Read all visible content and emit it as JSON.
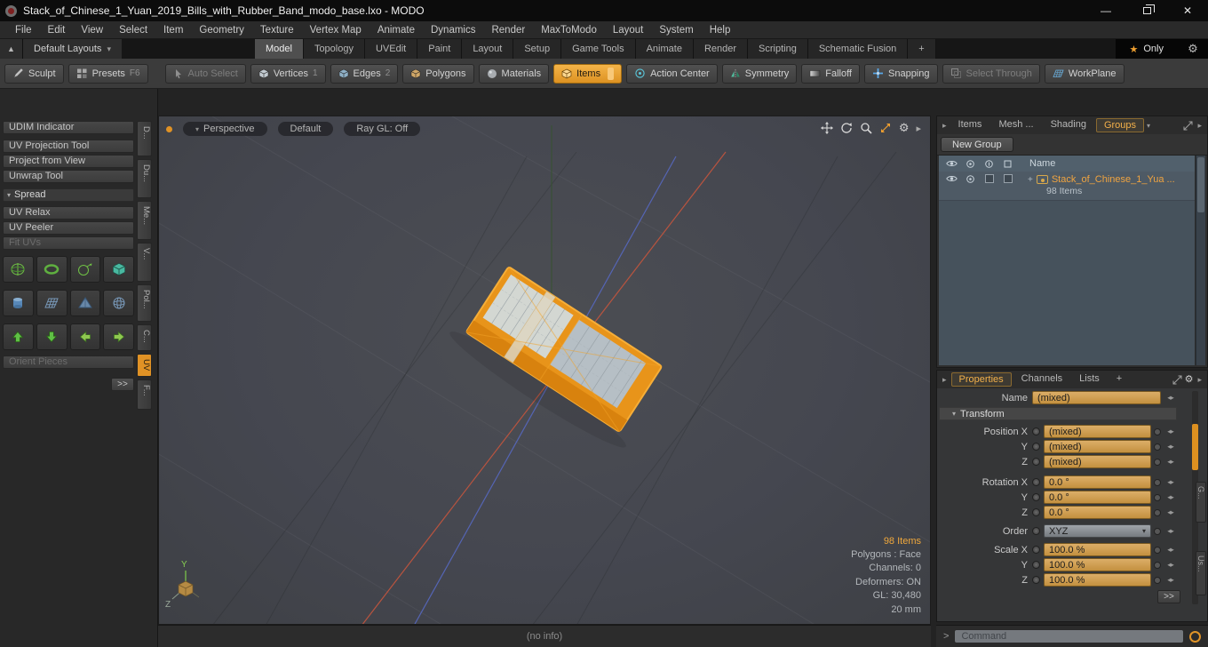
{
  "window": {
    "title": "Stack_of_Chinese_1_Yuan_2019_Bills_with_Rubber_Band_modo_base.lxo - MODO"
  },
  "icons": {
    "dropdown": "▾",
    "collapse": "▸",
    "section_open": "▼",
    "star": "★",
    "gear": "⚙",
    "up": "▲",
    "spin": "◂▸",
    "plus": "+",
    "minimize": "—",
    "close": "✕",
    "gt": ">"
  },
  "menu": {
    "items": [
      "File",
      "Edit",
      "View",
      "Select",
      "Item",
      "Geometry",
      "Texture",
      "Vertex Map",
      "Animate",
      "Dynamics",
      "Render",
      "MaxToModo",
      "Layout",
      "System",
      "Help"
    ]
  },
  "layout_bar": {
    "layouts_label": "Default Layouts",
    "tabs": [
      "Model",
      "Topology",
      "UVEdit",
      "Paint",
      "Layout",
      "Setup",
      "Game Tools",
      "Animate",
      "Render",
      "Scripting",
      "Schematic Fusion",
      "+"
    ],
    "only_label": "Only"
  },
  "toolbar": {
    "sculpt_label": "Sculpt",
    "presets_label": "Presets",
    "presets_shortcut": "F6",
    "auto_select": "Auto Select",
    "vertices": "Vertices",
    "vertices_shortcut": "1",
    "edges": "Edges",
    "edges_shortcut": "2",
    "polygons": "Polygons",
    "materials": "Materials",
    "items": "Items",
    "action_center": "Action Center",
    "symmetry": "Symmetry",
    "falloff": "Falloff",
    "snapping": "Snapping",
    "select_through": "Select Through",
    "workplane": "WorkPlane"
  },
  "left_panel": {
    "tools": [
      "UDIM Indicator",
      "UV Projection Tool",
      "Project from View",
      "Unwrap Tool"
    ],
    "spread_label": "Spread",
    "spread_tools": [
      "UV Relax",
      "UV Peeler",
      "Fit UVs"
    ],
    "orient_pieces": "Orient Pieces",
    "more_label": ">>",
    "side_tabs": [
      "D...",
      "Du...",
      "Me...",
      "V...",
      "Pol...",
      "C...",
      "UV",
      "F..."
    ]
  },
  "viewport": {
    "camera_label": "Perspective",
    "style_label": "Default",
    "raygl_label": "Ray GL: Off",
    "stats": [
      "98 Items",
      "Polygons : Face",
      "Channels: 0",
      "Deformers: ON",
      "GL: 30,480",
      "20 mm"
    ],
    "axis_y": "Y",
    "axis_z": "Z",
    "info_bar": "(no info)"
  },
  "items_panel": {
    "tabs": [
      "Items",
      "Mesh ...",
      "Shading",
      "Groups"
    ],
    "new_group_label": "New Group",
    "name_header": "Name",
    "row": {
      "name": "Stack_of_Chinese_1_Yua ...",
      "sub": "98 Items"
    }
  },
  "properties_panel": {
    "tabs": [
      "Properties",
      "Channels",
      "Lists",
      "+"
    ],
    "name_label": "Name",
    "name_value": "(mixed)",
    "transform_label": "Transform",
    "position": {
      "x_label": "Position X",
      "y_label": "Y",
      "z_label": "Z",
      "x": "(mixed)",
      "y": "(mixed)",
      "z": "(mixed)"
    },
    "rotation": {
      "x_label": "Rotation X",
      "y_label": "Y",
      "z_label": "Z",
      "x": "0.0 °",
      "y": "0.0 °",
      "z": "0.0 °"
    },
    "order_label": "Order",
    "order_value": "XYZ",
    "scale": {
      "x_label": "Scale X",
      "y_label": "Y",
      "z_label": "Z",
      "x": "100.0 %",
      "y": "100.0 %",
      "z": "100.0 %"
    },
    "more_label": ">>",
    "side_tabs": [
      "G...",
      "Us..."
    ]
  },
  "command_bar": {
    "placeholder": "Command"
  }
}
